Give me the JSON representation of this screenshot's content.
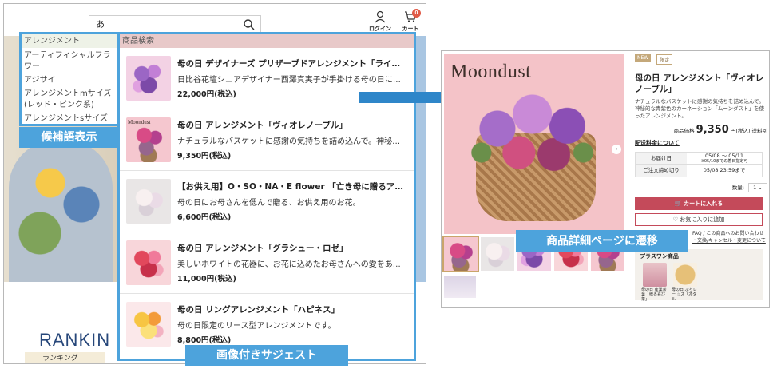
{
  "left_screenshot": {
    "search": {
      "value": "あ"
    },
    "header": {
      "login_label": "ログイン",
      "cart_label": "カート",
      "cart_count": "0"
    },
    "ranking": {
      "title": "RANKIN",
      "subtitle": "ランキング"
    },
    "candidates": {
      "title": "アレンジメント",
      "items": [
        "アーティフィシャルフラワー",
        "アジサイ",
        "アレンジメントmサイズ(レッド・ピンク系)",
        "アレンジメントsサイズ"
      ]
    },
    "candidate_label": "候補語表示",
    "product_search": {
      "header": "商品検索",
      "items": [
        {
          "title": "母の日 デザイナーズ プリザーブドアレンジメント「ライラッ…",
          "desc": "日比谷花壇シニアデザイナー西澤真実子が手掛ける母の日に贈…",
          "price": "22,000円(税込)",
          "thumb_color": "purple"
        },
        {
          "title": "母の日 アレンジメント「ヴィオレノーブル」",
          "desc": "ナチュラルなバスケットに感謝の気持ちを詰め込んで。神秘的…",
          "price": "9,350円(税込)",
          "thumb_color": "pink"
        },
        {
          "title": "【お供え用】O・SO・NA・E flower 「亡き母に贈るアレンジ…",
          "desc": "母の日にお母さんを偲んで贈る、お供え用のお花。",
          "price": "6,600円(税込)",
          "thumb_color": "white"
        },
        {
          "title": "母の日 アレンジメント「グラシュー・ロゼ」",
          "desc": "美しいホワイトの花器に、お花に込めたお母さんへの愛をあふ…",
          "price": "11,000円(税込)",
          "thumb_color": "red"
        },
        {
          "title": "母の日 リングアレンジメント「ハピネス」",
          "desc": "母の日限定のリース型アレンジメントです。",
          "price": "8,800円(税込)",
          "thumb_color": "yellow"
        }
      ]
    },
    "product_label": "画像付きサジェスト",
    "thumb_brand": "Moondust"
  },
  "right_screenshot": {
    "brand": "Moondust",
    "tags": {
      "new": "NEW",
      "limited": "限定"
    },
    "title": "母の日 アレンジメント「ヴィオレノーブル」",
    "desc": "ナチュラルなバスケットに感謝の気持ちを詰め込んで。神秘的な青紫色のカーネーション「ムーンダスト」を使ったアレンジメント。",
    "price_prefix": "商品価格",
    "price": "9,350",
    "price_suffix": "円(税込) 送料別",
    "shipping_link": "配送料金について",
    "delivery": {
      "label": "お届け日",
      "value": "05/08 〜 05/11",
      "note": "※05/10までの着日指定可",
      "order_label": "ご注文締め切り",
      "order_value": "05/08 23:59まで"
    },
    "qty_label": "数量:",
    "qty_value": "1",
    "cart_button": "カートに入れる",
    "fav_button": "お気に入りに追加",
    "links_1": "FAQ / この商品へのお問い合わせ",
    "links_2": "・交換/キャンセル・変更について",
    "plus_title": "プラスワン商品",
    "plus_items": [
      "母の日 産業茶葉「贈る喜び茶」",
      "母の日 ぷちレー ☆ス「オタル…"
    ]
  },
  "detail_label": "商品詳細ページに遷移",
  "colors": {
    "accent": "#4da3dc",
    "cart_button": "#c44a5a"
  }
}
